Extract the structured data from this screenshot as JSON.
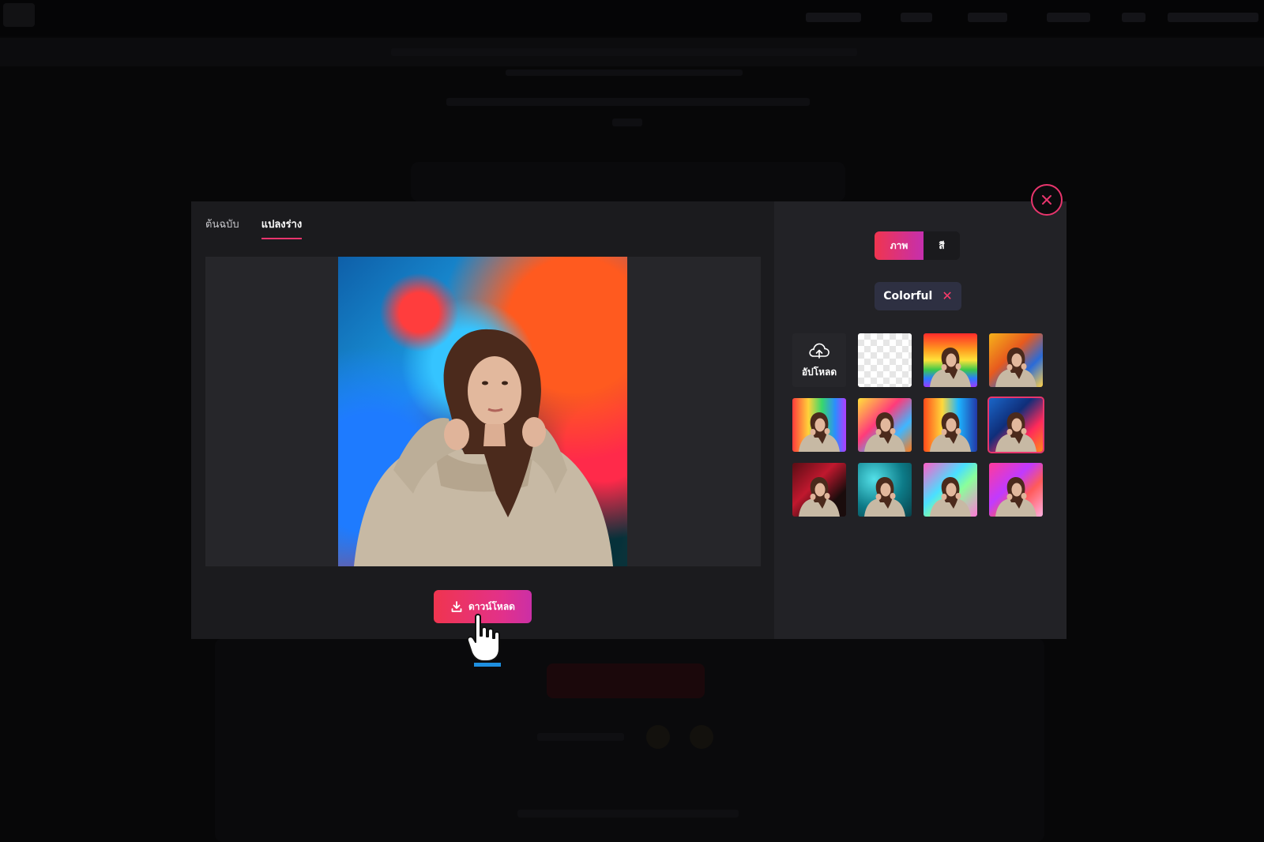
{
  "modal": {
    "tabs": [
      {
        "label": "ต้นฉบับ",
        "active": false
      },
      {
        "label": "แปลงร่าง",
        "active": true
      }
    ],
    "download_label": "ดาวน์โหลด",
    "segment": {
      "image_label": "ภาพ",
      "color_label": "สี",
      "selected": "ภาพ"
    },
    "filter_chip": {
      "label": "Colorful"
    },
    "upload_label": "อัปโหลด",
    "background_tiles": [
      {
        "name": "upload",
        "icon": "cloud-upload-icon"
      },
      {
        "name": "transparent"
      },
      {
        "name": "rainbow-paint"
      },
      {
        "name": "orange-blue-paint"
      },
      {
        "name": "rainbow-splash"
      },
      {
        "name": "yellow-pink-splash"
      },
      {
        "name": "stripes"
      },
      {
        "name": "blue-red-ink",
        "selected": true
      },
      {
        "name": "dark-red"
      },
      {
        "name": "teal-bokeh"
      },
      {
        "name": "pastel-neon"
      },
      {
        "name": "pink-purple"
      }
    ]
  },
  "colors": {
    "accent": "#e8356d",
    "gradient_start": "#f0354f",
    "gradient_end": "#c52fae",
    "modal_left_bg": "#1b1b1e",
    "modal_right_bg": "#222226",
    "chip_bg": "#2e3042"
  },
  "icons": {
    "download": "download-icon",
    "close": "close-icon",
    "cursor": "hand-pointer-icon"
  }
}
